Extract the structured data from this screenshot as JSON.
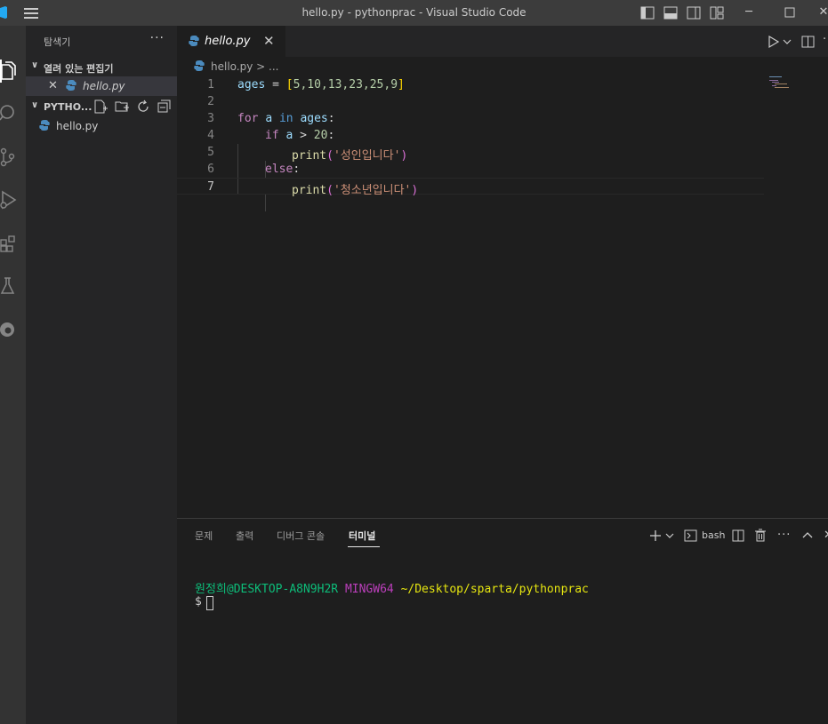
{
  "window": {
    "title": "hello.py - pythonprac - Visual Studio Code"
  },
  "activity_bar": {
    "items": [
      "explorer-icon",
      "search-icon",
      "source-control-icon",
      "run-debug-icon",
      "extensions-icon",
      "testing-icon",
      "edge-tools-icon"
    ]
  },
  "sidebar": {
    "title": "탐색기",
    "more": "···",
    "open_editors": {
      "label": "열려 있는 편집기",
      "items": [
        {
          "close": "✕",
          "name": "hello.py"
        }
      ]
    },
    "folder": {
      "label": "PYTHO...",
      "files": [
        {
          "name": "hello.py"
        }
      ]
    }
  },
  "editor": {
    "tab": {
      "name": "hello.py",
      "close": "✕"
    },
    "breadcrumb": "hello.py > ...",
    "current_line": 7,
    "line_numbers": [
      "1",
      "2",
      "3",
      "4",
      "5",
      "6",
      "7"
    ],
    "code": {
      "l1": {
        "var": "ages",
        "op": " = ",
        "open": "[",
        "nums": "5,10,13,23,25,9",
        "close": "]"
      },
      "l3": {
        "kw_for": "for",
        "sp1": " ",
        "var_a": "a",
        "sp2": " ",
        "kw_in": "in",
        "sp3": " ",
        "var_ages": "ages",
        "colon": ":"
      },
      "l4": {
        "kw_if": "if",
        "sp1": " ",
        "var_a": "a",
        "op": " > ",
        "num": "20",
        "colon": ":"
      },
      "l5": {
        "fn": "print",
        "open": "(",
        "str": "'성인입니다'",
        "close": ")"
      },
      "l6": {
        "kw_else": "else",
        "colon": ":"
      },
      "l7": {
        "fn": "print",
        "open": "(",
        "str": "'청소년입니다'",
        "close": ")"
      }
    }
  },
  "panel": {
    "tabs": [
      "문제",
      "출력",
      "디버그 콘솔",
      "터미널"
    ],
    "active_tab": "터미널",
    "shell": "bash",
    "terminal": {
      "user": "원정희@DESKTOP-A8N9H2R",
      "system": "MINGW64",
      "path": "~/Desktop/sparta/pythonprac",
      "prompt": "$"
    }
  },
  "colors": {
    "accent": "#007acc",
    "keyword": "#c586c0",
    "string": "#ce9178",
    "number": "#b5cea8",
    "function": "#dcdcaa",
    "terminal_user": "#0dbc79",
    "terminal_system": "#bc3fbc",
    "terminal_path": "#e5e510"
  }
}
